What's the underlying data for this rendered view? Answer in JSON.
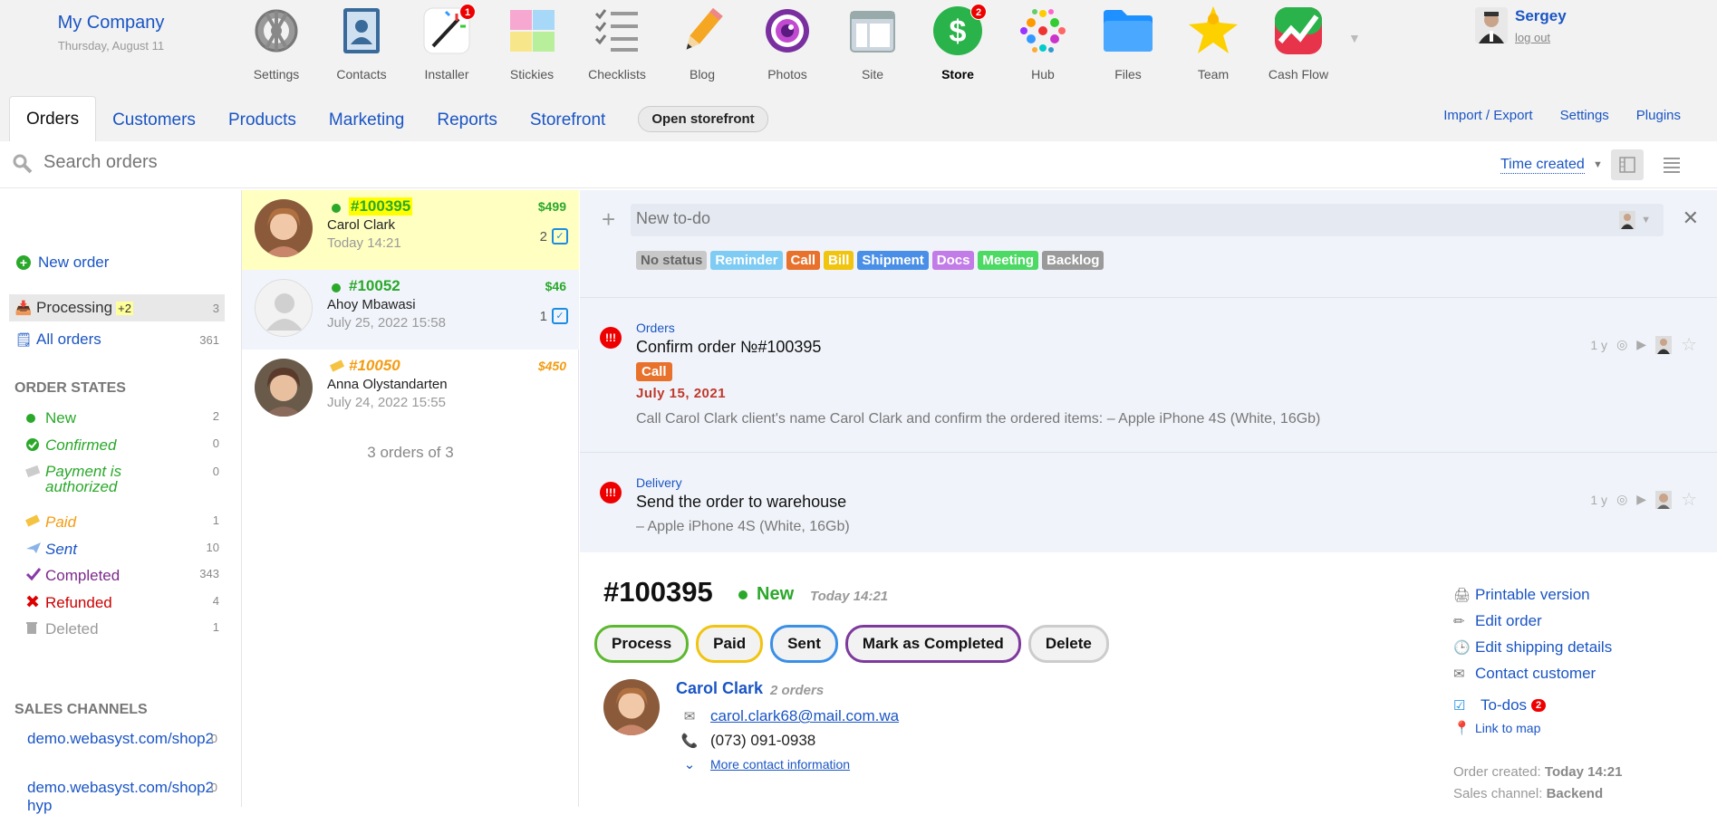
{
  "company": {
    "name": "My Company",
    "date": "Thursday, August 11"
  },
  "apps": [
    {
      "label": "Settings",
      "icon": "settings-icon",
      "badge": ""
    },
    {
      "label": "Contacts",
      "icon": "contacts-icon",
      "badge": ""
    },
    {
      "label": "Installer",
      "icon": "installer-icon",
      "badge": "1"
    },
    {
      "label": "Stickies",
      "icon": "stickies-icon",
      "badge": ""
    },
    {
      "label": "Checklists",
      "icon": "checklists-icon",
      "badge": ""
    },
    {
      "label": "Blog",
      "icon": "blog-icon",
      "badge": ""
    },
    {
      "label": "Photos",
      "icon": "photos-icon",
      "badge": ""
    },
    {
      "label": "Site",
      "icon": "site-icon",
      "badge": ""
    },
    {
      "label": "Store",
      "icon": "store-icon",
      "badge": "2"
    },
    {
      "label": "Hub",
      "icon": "hub-icon",
      "badge": ""
    },
    {
      "label": "Files",
      "icon": "files-icon",
      "badge": ""
    },
    {
      "label": "Team",
      "icon": "team-icon",
      "badge": ""
    },
    {
      "label": "Cash Flow",
      "icon": "cashflow-icon",
      "badge": ""
    }
  ],
  "user": {
    "name": "Sergey",
    "logout": "log out"
  },
  "tabs": [
    "Orders",
    "Customers",
    "Products",
    "Marketing",
    "Reports",
    "Storefront"
  ],
  "open_storefront": "Open storefront",
  "nav_right": [
    "Import / Export",
    "Settings",
    "Plugins"
  ],
  "search": {
    "placeholder": "Search orders"
  },
  "sort": {
    "label": "Time created"
  },
  "sidebar": {
    "new_order": "New order",
    "processing": {
      "label": "Processing",
      "extra": "+2",
      "count": "3"
    },
    "all_orders": {
      "label": "All orders",
      "count": "361"
    },
    "states_title": "Order states",
    "states": [
      {
        "label": "New",
        "count": "2",
        "color": "#2aa82a"
      },
      {
        "label": "Confirmed",
        "count": "0",
        "color": "#2aa82a"
      },
      {
        "label": "Payment is authorized",
        "count": "0",
        "color": "#2aa82a"
      },
      {
        "label": "Paid",
        "count": "1",
        "color": "#f39c12"
      },
      {
        "label": "Sent",
        "count": "10",
        "color": "#1a55c4"
      },
      {
        "label": "Completed",
        "count": "343",
        "color": "#7d2a8c"
      },
      {
        "label": "Refunded",
        "count": "4",
        "color": "#cc0000"
      },
      {
        "label": "Deleted",
        "count": "1",
        "color": "#999999"
      }
    ],
    "channels_title": "Sales channels",
    "channels": [
      {
        "label": "demo.webasyst.com/shop2",
        "count": "0"
      },
      {
        "label": "demo.webasyst.com/shop2hyp",
        "count": "0"
      }
    ]
  },
  "orders": [
    {
      "num": "#100395",
      "price": "$499",
      "customer": "Carol Clark",
      "date": "Today 14:21",
      "todos": "2"
    },
    {
      "num": "#10052",
      "price": "$46",
      "customer": "Ahoy Mbawasi",
      "date": "July 25, 2022 15:58",
      "todos": "1"
    },
    {
      "num": "#10050",
      "price": "$450",
      "customer": "Anna Olystandarten",
      "date": "July 24, 2022 15:55",
      "todos": ""
    }
  ],
  "orders_count": "3 orders of 3",
  "todo": {
    "placeholder": "New to-do",
    "tags": [
      {
        "label": "No status",
        "color": "#c8c8c8",
        "text": "#666666"
      },
      {
        "label": "Reminder",
        "color": "#7ecbf4",
        "text": "#ffffff"
      },
      {
        "label": "Call",
        "color": "#e8712c",
        "text": "#ffffff"
      },
      {
        "label": "Bill",
        "color": "#f1c40f",
        "text": "#ffffff"
      },
      {
        "label": "Shipment",
        "color": "#4a8fe7",
        "text": "#ffffff"
      },
      {
        "label": "Docs",
        "color": "#c27ce8",
        "text": "#ffffff"
      },
      {
        "label": "Meeting",
        "color": "#4cd964",
        "text": "#ffffff"
      },
      {
        "label": "Backlog",
        "color": "#9a9a9a",
        "text": "#ffffff"
      }
    ]
  },
  "tasks": [
    {
      "category": "Orders",
      "title": "Confirm order №#100395",
      "tag": "Call",
      "due": "July 15, 2021",
      "desc": "Call Carol Clark client's name Carol Clark and confirm the ordered items: – Apple iPhone 4S (White, 16Gb)",
      "age": "1 y"
    },
    {
      "category": "Delivery",
      "title": "Send the order to warehouse",
      "desc": "– Apple iPhone 4S (White, 16Gb)",
      "age": "1 y"
    }
  ],
  "detail": {
    "num": "#100395",
    "status": "New",
    "date": "Today 14:21",
    "actions": [
      {
        "label": "Process",
        "color": "#5cb82e"
      },
      {
        "label": "Paid",
        "color": "#f1c40f"
      },
      {
        "label": "Sent",
        "color": "#3a8fe7"
      },
      {
        "label": "Mark as Completed",
        "color": "#7d3a9c"
      },
      {
        "label": "Delete",
        "color": "#cccccc"
      }
    ],
    "customer": {
      "name": "Carol Clark",
      "orders": "2 orders",
      "email": "carol.clark68@mail.com.wa",
      "phone": "(073) 091-0938",
      "more": "More contact information"
    },
    "links": [
      "Printable version",
      "Edit order",
      "Edit shipping details",
      "Contact customer"
    ],
    "todos_label": "To-dos",
    "todos_count": "2",
    "map_label": "Link to map",
    "created_label": "Order created:",
    "created_value": "Today 14:21",
    "channel_label": "Sales channel:",
    "channel_value": "Backend"
  }
}
